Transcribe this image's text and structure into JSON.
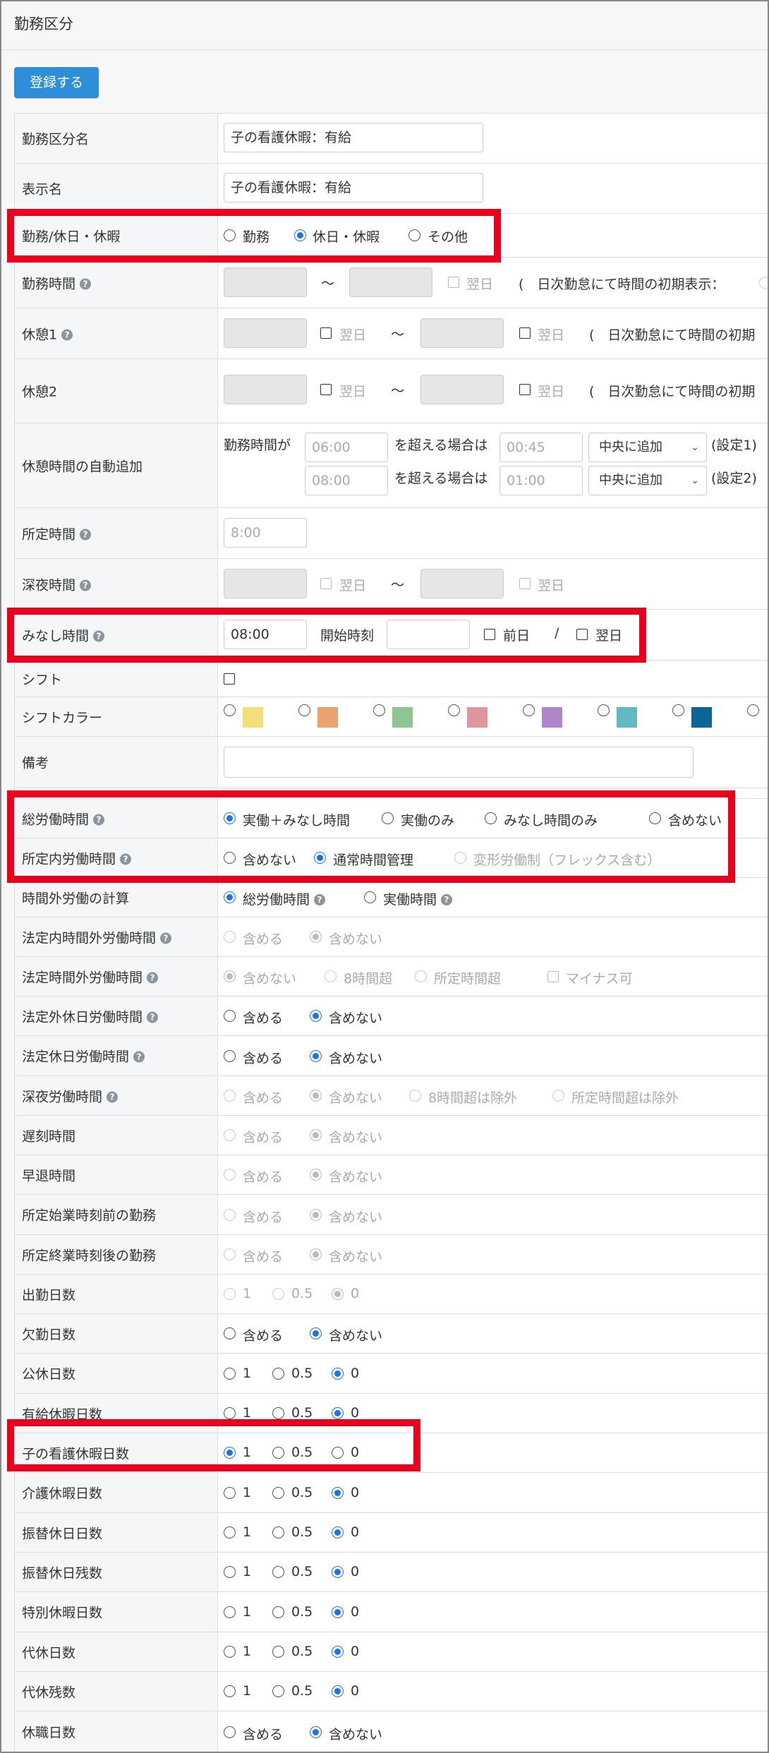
{
  "page": {
    "title": "勤務区分",
    "register_button": "登録する"
  },
  "fields": {
    "name": {
      "label": "勤務区分名",
      "value": "子の看護休暇：有給"
    },
    "display_name": {
      "label": "表示名",
      "value": "子の看護休暇：有給"
    },
    "type": {
      "label": "勤務/休日・休暇",
      "options": [
        "勤務",
        "休日・休暇",
        "その他"
      ],
      "selected": "休日・休暇"
    },
    "work_time": {
      "label": "勤務時間",
      "tilde": "〜",
      "next_day": "翌日",
      "note": "(　日次勤怠にて時間の初期表示："
    },
    "break1": {
      "label": "休憩1",
      "next_day": "翌日",
      "tilde": "〜",
      "note": "(　日次勤怠にて時間の初期"
    },
    "break2": {
      "label": "休憩2",
      "next_day": "翌日",
      "tilde": "〜",
      "note": "(　日次勤怠にて時間の初期"
    },
    "auto_break": {
      "label": "休憩時間の自動追加",
      "prefix": "勤務時間が",
      "rules": [
        {
          "threshold": "06:00",
          "text": "を超える場合は",
          "break": "00:45",
          "position": "中央に追加",
          "setting": "(設定1)"
        },
        {
          "threshold": "08:00",
          "text": "を超える場合は",
          "break": "01:00",
          "position": "中央に追加",
          "setting": "(設定2)"
        }
      ]
    },
    "scheduled_time": {
      "label": "所定時間",
      "placeholder": "8:00"
    },
    "night_time": {
      "label": "深夜時間",
      "next_day": "翌日",
      "tilde": "〜"
    },
    "deemed_time": {
      "label": "みなし時間",
      "value": "08:00",
      "start_label": "開始時刻",
      "prev_day": "前日",
      "slash": "/",
      "next_day": "翌日"
    },
    "shift": {
      "label": "シフト"
    },
    "shift_color": {
      "label": "シフトカラー",
      "colors": [
        "#f1e07a",
        "#e8a46c",
        "#8fc593",
        "#e0959c",
        "#b184cc",
        "#62b9c4",
        "#0d6596"
      ]
    },
    "remarks": {
      "label": "備考"
    },
    "total_labor": {
      "label": "総労働時間",
      "options": [
        "実働＋みなし時間",
        "実働のみ",
        "みなし時間のみ",
        "含めない"
      ],
      "selected": "実働＋みなし時間"
    },
    "scheduled_labor": {
      "label": "所定内労働時間",
      "options": [
        "含めない",
        "通常時間管理",
        "変形労働制（フレックス含む）"
      ],
      "selected": "通常時間管理"
    },
    "overtime_calc": {
      "label": "時間外労働の計算",
      "options": [
        "総労働時間",
        "実働時間"
      ],
      "selected": "総労働時間"
    },
    "legal_inner_overtime": {
      "label": "法定内時間外労働時間",
      "options": [
        "含める",
        "含めない"
      ],
      "selected": "含めない"
    },
    "legal_overtime": {
      "label": "法定時間外労働時間",
      "options": [
        "含めない",
        "8時間超",
        "所定時間超"
      ],
      "selected": "含めない",
      "checkbox": "マイナス可"
    },
    "non_legal_holiday": {
      "label": "法定外休日労働時間",
      "options": [
        "含める",
        "含めない"
      ],
      "selected": "含めない"
    },
    "legal_holiday": {
      "label": "法定休日労働時間",
      "options": [
        "含める",
        "含めない"
      ],
      "selected": "含めない"
    },
    "night_labor": {
      "label": "深夜労働時間",
      "options": [
        "含める",
        "含めない",
        "8時間超は除外",
        "所定時間超は除外"
      ],
      "selected": "含めない"
    },
    "late": {
      "label": "遅刻時間",
      "options": [
        "含める",
        "含めない"
      ],
      "selected": "含めない"
    },
    "early_leave": {
      "label": "早退時間",
      "options": [
        "含める",
        "含めない"
      ],
      "selected": "含めない"
    },
    "before_start": {
      "label": "所定始業時刻前の勤務",
      "options": [
        "含める",
        "含めない"
      ],
      "selected": "含めない"
    },
    "after_end": {
      "label": "所定終業時刻後の勤務",
      "options": [
        "含める",
        "含めない"
      ],
      "selected": "含めない"
    },
    "attendance_days": {
      "label": "出勤日数",
      "options": [
        "1",
        "0.5",
        "0"
      ],
      "selected": "0"
    },
    "absence_days": {
      "label": "欠勤日数",
      "options": [
        "含める",
        "含めない"
      ],
      "selected": "含めない"
    },
    "public_holiday_days": {
      "label": "公休日数",
      "options": [
        "1",
        "0.5",
        "0"
      ],
      "selected": "0"
    },
    "paid_leave_days": {
      "label": "有給休暇日数",
      "options": [
        "1",
        "0.5",
        "0"
      ],
      "selected": "0"
    },
    "child_care_leave_days": {
      "label": "子の看護休暇日数",
      "options": [
        "1",
        "0.5",
        "0"
      ],
      "selected": "1"
    },
    "nursing_care_leave_days": {
      "label": "介護休暇日数",
      "options": [
        "1",
        "0.5",
        "0"
      ],
      "selected": "0"
    },
    "substitute_holiday_days": {
      "label": "振替休日日数",
      "options": [
        "1",
        "0.5",
        "0"
      ],
      "selected": "0"
    },
    "substitute_holiday_remaining": {
      "label": "振替休日残数",
      "options": [
        "1",
        "0.5",
        "0"
      ],
      "selected": "0"
    },
    "special_leave_days": {
      "label": "特別休暇日数",
      "options": [
        "1",
        "0.5",
        "0"
      ],
      "selected": "0"
    },
    "compensatory_days": {
      "label": "代休日数",
      "options": [
        "1",
        "0.5",
        "0"
      ],
      "selected": "0"
    },
    "compensatory_remaining": {
      "label": "代休残数",
      "options": [
        "1",
        "0.5",
        "0"
      ],
      "selected": "0"
    },
    "leave_of_absence_days": {
      "label": "休職日数",
      "options": [
        "含める",
        "含めない"
      ],
      "selected": "含めない"
    }
  },
  "theme": {
    "accent": "#2d8fd8",
    "radio_selected": "#1a73e8",
    "highlight": "#e8001c"
  }
}
